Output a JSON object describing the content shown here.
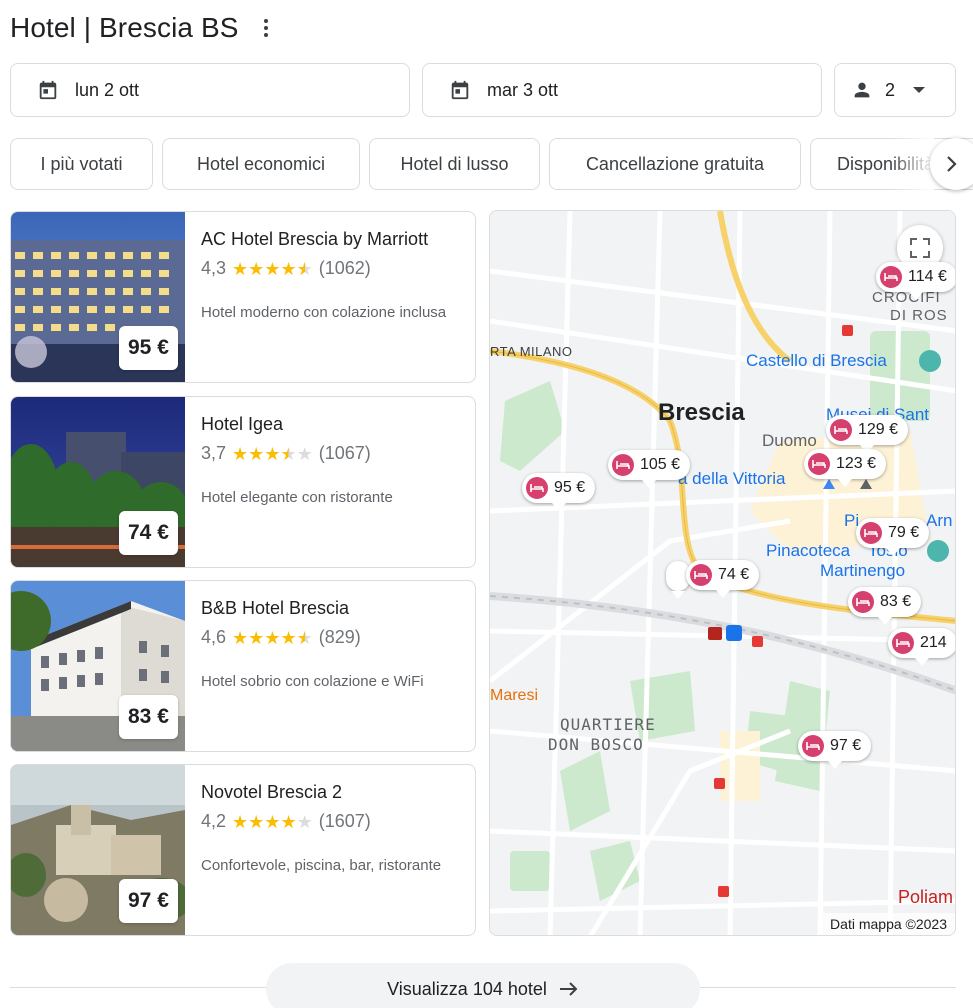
{
  "header": {
    "title": "Hotel | Brescia BS",
    "more_icon": "more-vert-icon"
  },
  "search": {
    "checkin": "lun 2 ott",
    "checkout": "mar 3 ott",
    "guests": "2"
  },
  "chips": [
    {
      "label": "I più votati"
    },
    {
      "label": "Hotel economici"
    },
    {
      "label": "Hotel di lusso"
    },
    {
      "label": "Cancellazione gratuita"
    },
    {
      "label": "Disponibilità"
    }
  ],
  "hotels": [
    {
      "name": "AC Hotel Brescia by Marriott",
      "rating": "4,3",
      "rating_value": 4.3,
      "reviews": "(1062)",
      "description": "Hotel moderno con colazione inclusa",
      "price": "95 €"
    },
    {
      "name": "Hotel Igea",
      "rating": "3,7",
      "rating_value": 3.7,
      "reviews": "(1067)",
      "description": "Hotel elegante con ristorante",
      "price": "74 €"
    },
    {
      "name": "B&B Hotel Brescia",
      "rating": "4,6",
      "rating_value": 4.6,
      "reviews": "(829)",
      "description": "Hotel sobrio con colazione e WiFi",
      "price": "83 €"
    },
    {
      "name": "Novotel Brescia 2",
      "rating": "4,2",
      "rating_value": 4.2,
      "reviews": "(1607)",
      "description": "Confortevole, piscina, bar, ristorante",
      "price": "97 €"
    }
  ],
  "map": {
    "labels": {
      "city": "Brescia",
      "porta_milano": "RTA MILANO",
      "castello": "Castello di Brescia",
      "duomo": "Duomo",
      "musei": "Musei di Sant",
      "vittoria": "a della Vittoria",
      "pinacoteca": "Pinacoteca",
      "tosio": "Tosio",
      "martinengo": "Martinengo",
      "piazza": "Pi",
      "arn": "Arn",
      "crocifissa": "CROCIFI",
      "di_rosa": "DI ROS",
      "quartiere": "QUARTIERE",
      "don_bosco": "DON BOSCO",
      "maresi": "Maresi",
      "poliam": "Poliam"
    },
    "pins": [
      {
        "price": "114 €"
      },
      {
        "price": "129 €"
      },
      {
        "price": "123 €"
      },
      {
        "price": "105 €"
      },
      {
        "price": "95 €"
      },
      {
        "price": "79 €"
      },
      {
        "price": "74 €"
      },
      {
        "price": "83 €"
      },
      {
        "price": "214"
      },
      {
        "price": "97 €"
      }
    ],
    "attribution": "Dati mappa ©2023"
  },
  "footer": {
    "view_all": "Visualizza 104 hotel"
  },
  "colors": {
    "star": "#fbbc04",
    "pin": "#d6406f",
    "road_major": "#f7d26b",
    "park": "#cce9cd"
  }
}
